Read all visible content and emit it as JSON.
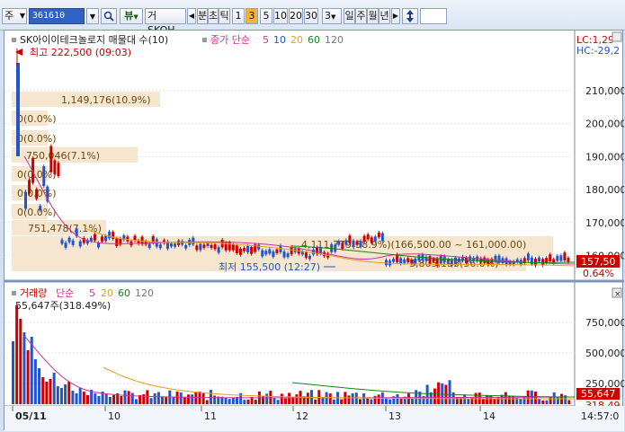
{
  "toolbar": {
    "market_label": "주",
    "code_value": "361610",
    "grid_icon_label": "뷰",
    "name_value": "거 SKOH",
    "period_prefix": "분",
    "tick_label": "초",
    "unit_label": "틱",
    "interval_options": [
      "1",
      "3",
      "5",
      "10",
      "20",
      "30"
    ],
    "selected_interval": "3",
    "count_value": "3",
    "day_label": "일",
    "week_label": "주",
    "month_label": "월",
    "year_label": "년",
    "step_value": ""
  },
  "price_panel": {
    "legend_name": "SK아이이테크놀로지 매물대 수(10)",
    "legend_close": "종가 단순",
    "ma_periods": [
      "5",
      "10",
      "20",
      "60",
      "120"
    ],
    "ma_colors": [
      "#cc3399",
      "#2255cc",
      "#e6a020",
      "#118811",
      "#777777"
    ],
    "high_label": "최고 222,500 (09:03)",
    "low_label": "최저 155,500 (12:27)",
    "lc_label": "LC:1,29",
    "hc_label": "HC:-29,2",
    "current_price": "157,50",
    "change_pct": "0.64%",
    "axis_ticks": [
      "210,000",
      "200,000",
      "190,000",
      "180,000",
      "170,000",
      "160,000"
    ],
    "volume_profile": [
      {
        "label": "1,149,176(10.9%)"
      },
      {
        "label": "0(0.0%)"
      },
      {
        "label": "0(0.0%)"
      },
      {
        "label": "750,046(7.1%)"
      },
      {
        "label": "0(0.0%)"
      },
      {
        "label": "0(0.0%)"
      },
      {
        "label": "0(0.0%)"
      },
      {
        "label": "751,478(7.1%)"
      },
      {
        "label": "4,111,779(38.9%)(166,500.00 ~ 161,000.00)"
      },
      {
        "label": "3,805,193(36.0%)"
      }
    ]
  },
  "volume_panel": {
    "legend_name": "거래량",
    "legend_ma": "단순",
    "ma_periods": [
      "5",
      "20",
      "60",
      "120"
    ],
    "peak_label": "55,647주(318.49%)",
    "axis_ticks": [
      "750,000",
      "500,000",
      "250,000"
    ],
    "current_volume": "55,647",
    "current_pct": "318.49"
  },
  "x_axis": {
    "labels": [
      "05/11",
      "10",
      "11",
      "12",
      "13",
      "14"
    ],
    "time_label": "14:57:0"
  }
}
